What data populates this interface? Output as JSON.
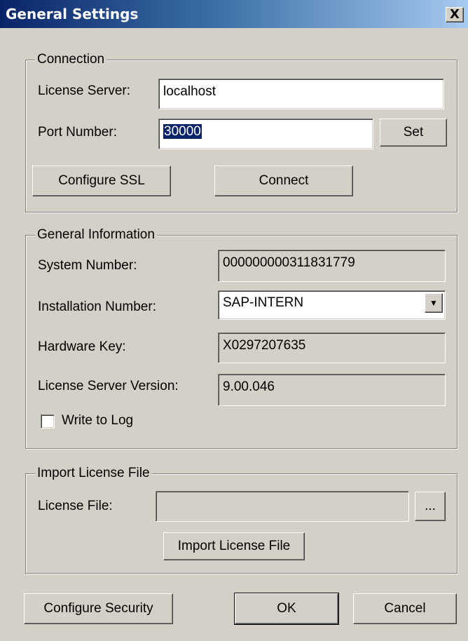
{
  "window": {
    "title": "General Settings",
    "close_label": "X"
  },
  "connection": {
    "legend": "Connection",
    "license_server_label": "License Server:",
    "license_server_value": "localhost",
    "port_label": "Port Number:",
    "port_value": "30000",
    "set_button": "Set",
    "configure_ssl_button": "Configure SSL",
    "connect_button": "Connect"
  },
  "general_info": {
    "legend": "General Information",
    "system_number_label": "System Number:",
    "system_number_value": "000000000311831779",
    "installation_number_label": "Installation Number:",
    "installation_number_value": "SAP-INTERN",
    "hardware_key_label": "Hardware Key:",
    "hardware_key_value": "X0297207635",
    "server_version_label": "License Server Version:",
    "server_version_value": "9.00.046",
    "write_to_log_label": "Write to Log",
    "write_to_log_checked": false
  },
  "import_license": {
    "legend": "Import License File",
    "license_file_label": "License File:",
    "license_file_value": "",
    "browse_button": "...",
    "import_button": "Import License File"
  },
  "footer": {
    "configure_security_button": "Configure Security",
    "ok_button": "OK",
    "cancel_button": "Cancel"
  }
}
